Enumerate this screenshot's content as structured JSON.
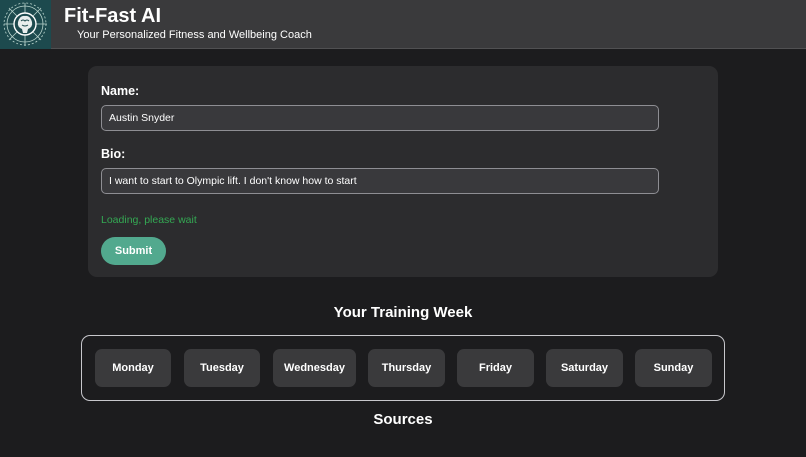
{
  "header": {
    "title": "Fit-Fast AI",
    "subtitle": "Your Personalized Fitness and Wellbeing Coach"
  },
  "form": {
    "name_label": "Name:",
    "name_value": "Austin Snyder",
    "bio_label": "Bio:",
    "bio_value": "I want to start to Olympic lift. I don't know how to start",
    "loading_text": "Loading, please wait",
    "submit_label": "Submit"
  },
  "training_week": {
    "title": "Your Training Week",
    "days": [
      "Monday",
      "Tuesday",
      "Wednesday",
      "Thursday",
      "Friday",
      "Saturday",
      "Sunday"
    ]
  },
  "sources": {
    "title": "Sources"
  },
  "colors": {
    "background": "#1c1c1e",
    "header": "#3a3a3c",
    "card": "#2c2c2e",
    "accent": "#52a98e",
    "loading": "#34a853"
  },
  "icons": {
    "logo": "fitness-brain-logo-icon"
  }
}
